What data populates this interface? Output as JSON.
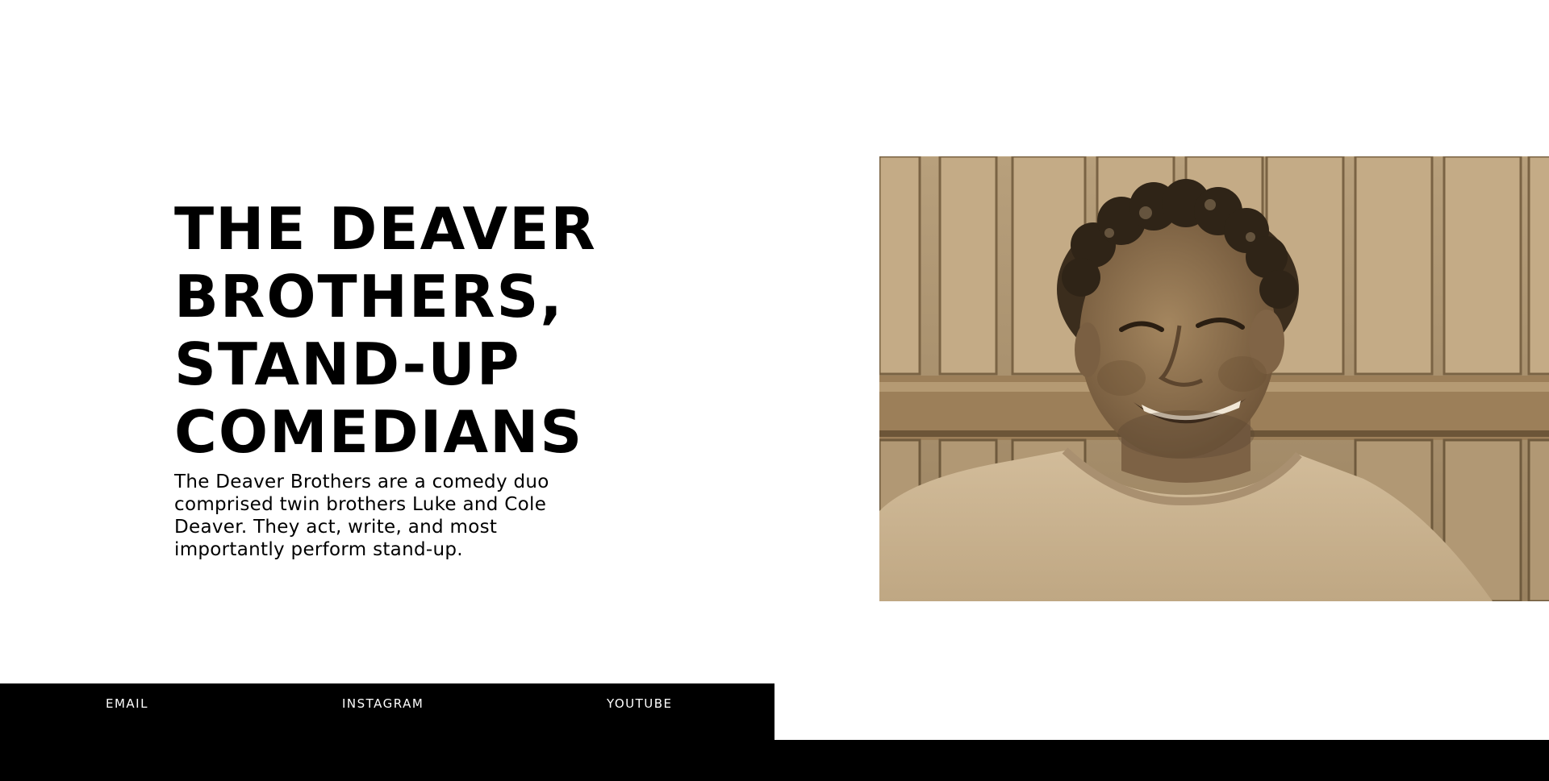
{
  "hero": {
    "title_lines": [
      "THE DEAVER",
      "BROTHERS,",
      "STAND-UP",
      "COMEDIANS"
    ],
    "description": "The Deaver Brothers are a comedy duo comprised twin brothers Luke and Cole Deaver. They act, write, and most importantly perform stand-up."
  },
  "photo": {
    "tone": "sepia",
    "colors": {
      "background": "#a8906b",
      "fence_light": "#b9a07a",
      "fence_dark": "#6e5a3e",
      "shirt": "#cdb796",
      "skin": "#8b6e4e",
      "hair": "#3a2c1c"
    }
  },
  "footer": {
    "links": [
      {
        "label": "EMAIL"
      },
      {
        "label": "INSTAGRAM"
      },
      {
        "label": "YOUTUBE"
      }
    ]
  },
  "colors": {
    "background": "#ffffff",
    "text": "#000000",
    "footer": "#000000",
    "footer_text": "#ffffff"
  }
}
